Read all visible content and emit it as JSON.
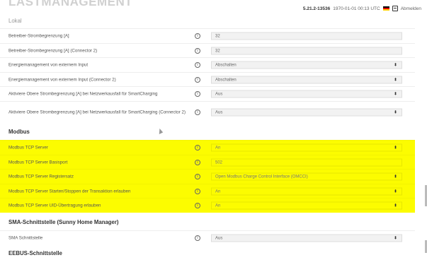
{
  "page": {
    "title": "LASTMANAGEMENT"
  },
  "topbar": {
    "version": "5.21.2-13536",
    "datetime": "1970-01-01 00:13 UTC",
    "logout_label": "Abmelden"
  },
  "sections": {
    "lokal": "Lokal",
    "modbus": "Modbus",
    "sma": "SMA-Schnittstelle (Sunny Home Manager)",
    "eebus": "EEBUS-Schnittstelle"
  },
  "rows": [
    {
      "label": "Betreiber-Strombegrenzung [A]",
      "value": "32",
      "type": "input"
    },
    {
      "label": "Betreiber-Strombegrenzung [A] (Connector 2)",
      "value": "32",
      "type": "input"
    },
    {
      "label": "Energiemanagement von externem Input",
      "value": "Abschalten",
      "type": "select"
    },
    {
      "label": "Energiemanagement von externem Input (Connector 2)",
      "value": "Abschalten",
      "type": "select"
    },
    {
      "label": "Aktiviere Obere Strombegrenzung [A] bei Netzwerkausfall für SmartCharging",
      "value": "Aus",
      "type": "select"
    },
    {
      "label": "Aktiviere Obere Strombegrenzung [A] bei Netzwerkausfall für SmartCharging (Connector 2)",
      "value": "Aus",
      "type": "select"
    },
    {
      "label": "Modbus TCP Server",
      "value": "An",
      "type": "select"
    },
    {
      "label": "Modbus TCP Server Basisport",
      "value": "502",
      "type": "input"
    },
    {
      "label": "Modbus TCP Server Registersatz",
      "value": "Open Modbus Charge Control Interface (OMCCI)",
      "type": "select"
    },
    {
      "label": "Modbus TCP Server Starten/Stoppen der Transaktion erlauben",
      "value": "An",
      "type": "select"
    },
    {
      "label": "Modbus TCP Server UID-Übertragung erlauben",
      "value": "An",
      "type": "select"
    },
    {
      "label": "SMA Schnittstelle",
      "value": "Aus",
      "type": "select"
    }
  ],
  "icons": {
    "info": "info-icon",
    "caret": "select-caret-icon",
    "flag": "german-flag-icon",
    "logout": "logout-icon"
  },
  "colors": {
    "highlight": "#fcfc00"
  }
}
